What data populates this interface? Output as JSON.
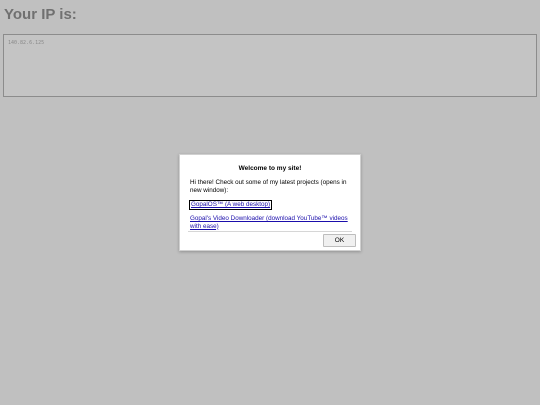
{
  "page": {
    "heading": "Your IP is:",
    "ip_value": "140.82.6.125"
  },
  "dialog": {
    "title": "Welcome to my site!",
    "message": "Hi there! Check out some of my latest projects (opens in new window):",
    "links": [
      {
        "label": "GopalOS™ (A web desktop)"
      },
      {
        "label": "Gopal's Video Downloader (download YouTube™ videos with ease)"
      }
    ],
    "ok_label": "OK"
  },
  "colors": {
    "background": "#c0c0c0",
    "link": "#1a0dab",
    "heading": "#707070"
  }
}
